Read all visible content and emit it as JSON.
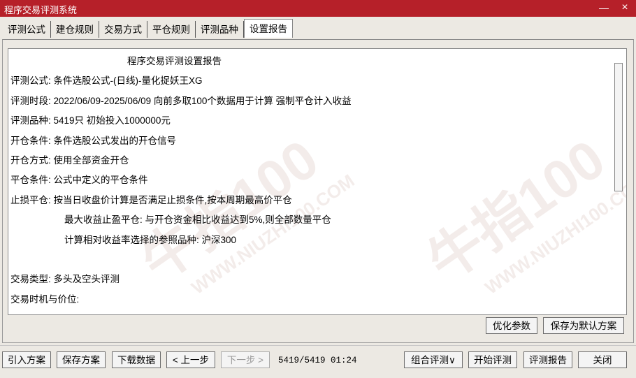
{
  "window": {
    "title": "程序交易评测系统",
    "minimize_glyph": "—",
    "close_glyph": "×"
  },
  "tabs": [
    {
      "label": "评测公式"
    },
    {
      "label": "建仓规则"
    },
    {
      "label": "交易方式"
    },
    {
      "label": "平仓规则"
    },
    {
      "label": "评测品种"
    },
    {
      "label": "设置报告",
      "active": true
    }
  ],
  "report": {
    "heading": "程序交易评测设置报告",
    "lines": [
      "评测公式: 条件选股公式-(日线)-量化捉妖王XG",
      "评测时段: 2022/06/09-2025/06/09 向前多取100个数据用于计算 强制平仓计入收益",
      "评测品种: 5419只 初始投入1000000元",
      "开仓条件: 条件选股公式发出的开仓信号",
      "开仓方式: 使用全部资金开仓",
      "平仓条件: 公式中定义的平仓条件",
      "止损平仓: 按当日收盘价计算是否满足止损条件,按本周期最高价平仓",
      "最大收益止盈平仓: 与开仓资金相比收益达到5%,则全部数量平仓",
      "计算相对收益率选择的参照品种: 沪深300",
      "交易类型: 多头及空头评测",
      "交易时机与价位:"
    ],
    "watermark_text": "牛指100",
    "watermark_url": "WWW.NIUZHI100.COM"
  },
  "panel_buttons": {
    "optimize": "优化参数",
    "save_default": "保存为默认方案"
  },
  "bottom": {
    "import": "引入方案",
    "save": "保存方案",
    "download": "下载数据",
    "prev": "< 上一步",
    "next": "下一步 >",
    "status": "5419/5419 01:24",
    "combo": "组合评测∨",
    "start": "开始评测",
    "report": "评测报告",
    "close": "关闭"
  },
  "colors": {
    "titlebar": "#B62029",
    "background": "#ECE9E3"
  }
}
